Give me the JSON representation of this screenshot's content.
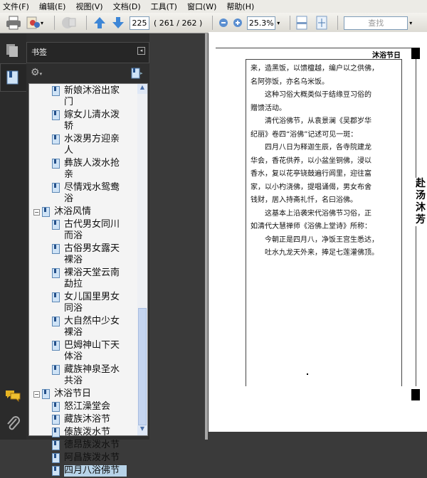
{
  "menu": [
    "文件(F)",
    "编辑(E)",
    "视图(V)",
    "文档(D)",
    "工具(T)",
    "窗口(W)",
    "帮助(H)"
  ],
  "toolbar": {
    "page_value": "225",
    "page_count": "( 261 / 262 )",
    "zoom_value": "25.3%",
    "find_placeholder": "查找"
  },
  "panel": {
    "title": "书签"
  },
  "tree": [
    {
      "level": 1,
      "label": "新娘沐浴出家门"
    },
    {
      "level": 1,
      "label": "嫁女儿清水泼轿"
    },
    {
      "level": 1,
      "label": "水泼男方迎亲人"
    },
    {
      "level": 1,
      "label": "彝族人泼水抢亲"
    },
    {
      "level": 1,
      "label": "尽情戏水鸳鸯浴"
    },
    {
      "level": 0,
      "label": "沐浴风情"
    },
    {
      "level": 1,
      "label": "古代男女同川而浴"
    },
    {
      "level": 1,
      "label": "古俗男女露天裸浴"
    },
    {
      "level": 1,
      "label": "裸浴天堂云南勐拉"
    },
    {
      "level": 1,
      "label": "女儿国里男女同浴"
    },
    {
      "level": 1,
      "label": "大自然中少女裸浴"
    },
    {
      "level": 1,
      "label": "巴姆神山下天体浴"
    },
    {
      "level": 1,
      "label": "藏族神泉圣水共浴"
    },
    {
      "level": 0,
      "label": "沐浴节日"
    },
    {
      "level": 1,
      "label": "怒江澡堂会"
    },
    {
      "level": 1,
      "label": "藏族沐浴节"
    },
    {
      "level": 1,
      "label": "傣族泼水节"
    },
    {
      "level": 1,
      "label": "德昂族泼水节"
    },
    {
      "level": 1,
      "label": "阿昌族泼水节"
    },
    {
      "level": 1,
      "label": "四月八浴佛节",
      "selected": true
    }
  ],
  "page": {
    "header": "沐浴节日",
    "side_title": "赴汤沐芳",
    "lines": [
      "来，造黑饭，以馈檀越，编户以之供佛，",
      "名阿弥饭，亦名乌米饭。",
      "　　这种习俗大概类似于结缘豆习俗的",
      "赠馈活动。",
      "　　清代浴佛节，从袁景澜《吴郡岁华",
      "纪丽》卷四“浴佛”记述可见一斑：",
      "　　四月八日为释迦生辰，各寺院建龙",
      "华会，香花供养，以小盆坐铜佛，浸以",
      "香水，复以花亭铙鼓遍行闾里，迎往富",
      "家，以小杓浇佛，提唱诵偈，男女布舍",
      "钱财，居入持斋礼忏，名曰浴佛。",
      "　　这基本上沿袭宋代浴佛节习俗，正",
      "如清代大慧禅师《浴佛上堂诗》所称：",
      "　　今朝正是四月八，净饭王宫生悉达，",
      "　　吐水九龙天外来，捧足七莲灌佛顶。"
    ]
  }
}
